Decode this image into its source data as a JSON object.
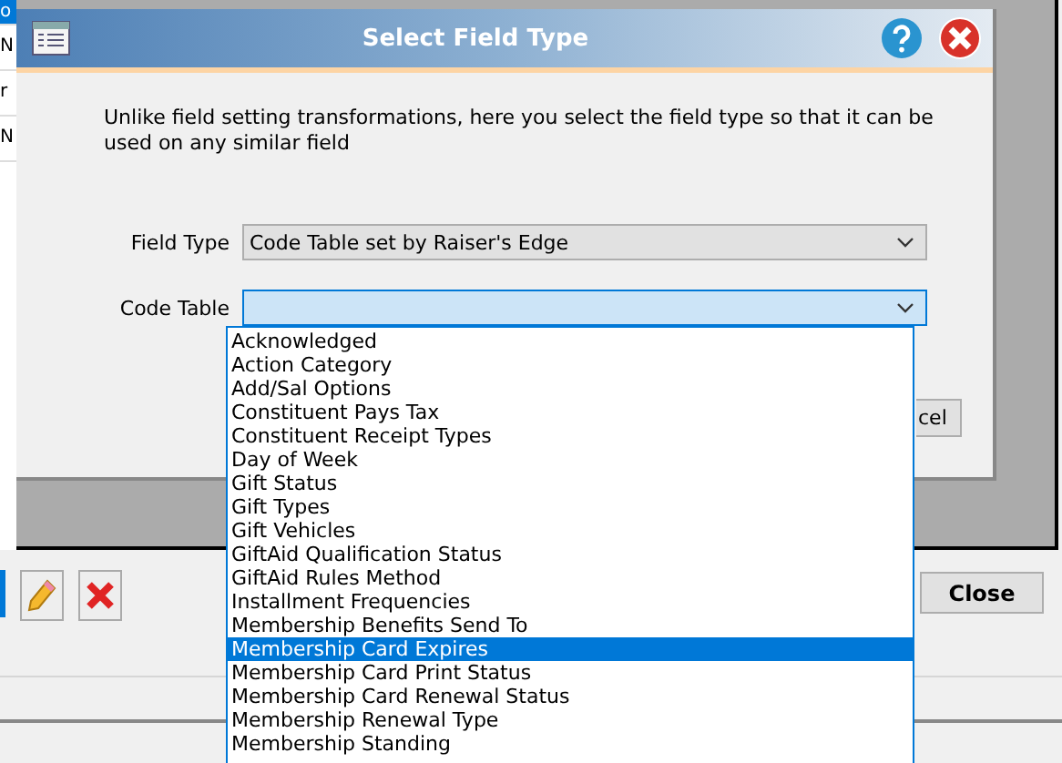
{
  "background_grid": {
    "rows": [
      {
        "text": "o",
        "selected": true
      },
      {
        "text": "N",
        "selected": false
      },
      {
        "text": "r",
        "selected": false
      },
      {
        "text": "N",
        "selected": false
      }
    ]
  },
  "toolbar": {
    "close_button": "Close"
  },
  "dialog": {
    "title": "Select Field Type",
    "description": "Unlike field setting transformations, here you select the field type so that it can be used on any similar field",
    "fields": [
      {
        "label": "Field Type",
        "value": "Code Table set by Raiser's Edge",
        "focused": false
      },
      {
        "label": "Code Table",
        "focused": true
      }
    ],
    "cancel_button": "cel"
  },
  "dropdown_list": [
    {
      "text": "Acknowledged",
      "selected": false
    },
    {
      "text": "Action Category",
      "selected": false
    },
    {
      "text": "Add/Sal Options",
      "selected": false
    },
    {
      "text": "Constituent Pays Tax",
      "selected": false
    },
    {
      "text": "Constituent Receipt Types",
      "selected": false
    },
    {
      "text": "Day of Week",
      "selected": false
    },
    {
      "text": "Gift Status",
      "selected": false
    },
    {
      "text": "Gift Types",
      "selected": false
    },
    {
      "text": "Gift Vehicles",
      "selected": false
    },
    {
      "text": "GiftAid Qualification Status",
      "selected": false
    },
    {
      "text": "GiftAid Rules Method",
      "selected": false
    },
    {
      "text": "Installment Frequencies",
      "selected": false
    },
    {
      "text": "Membership Benefits Send To",
      "selected": false
    },
    {
      "text": "Membership Card Expires",
      "selected": true
    },
    {
      "text": "Membership Card Print Status",
      "selected": false
    },
    {
      "text": "Membership Card Renewal Status",
      "selected": false
    },
    {
      "text": "Membership Renewal Type",
      "selected": false
    },
    {
      "text": "Membership Standing",
      "selected": false
    }
  ]
}
